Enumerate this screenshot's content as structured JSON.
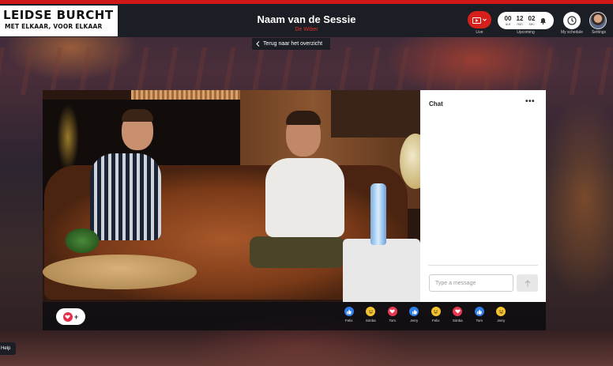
{
  "brand": {
    "line1": "LEIDSE BURCHT",
    "line2": "MET ELKAAR, VOOR ELKAAR"
  },
  "session": {
    "title": "Naam van de Sessie",
    "subtitle": "De Wiber"
  },
  "header": {
    "live_label": "Live",
    "countdown": [
      {
        "value": "00",
        "unit": "uur"
      },
      {
        "value": "12",
        "unit": "min"
      },
      {
        "value": "02",
        "unit": "sec"
      }
    ],
    "upcoming_label": "Upcoming",
    "schedule_label": "My schedule",
    "settings_label": "Settings"
  },
  "nav": {
    "back_label": "Terug naar het overzicht"
  },
  "chat": {
    "title": "Chat",
    "more": "•••",
    "input_placeholder": "Type a message"
  },
  "reactions": [
    {
      "type": "like",
      "name": "Felix"
    },
    {
      "type": "haha",
      "name": "Simba"
    },
    {
      "type": "love",
      "name": "Tom"
    },
    {
      "type": "like",
      "name": "Jerry"
    },
    {
      "type": "haha",
      "name": "Felix"
    },
    {
      "type": "love",
      "name": "Simba"
    },
    {
      "type": "like",
      "name": "Tom"
    },
    {
      "type": "haha",
      "name": "Jerry"
    }
  ],
  "help_label": "Help",
  "colors": {
    "accent_red": "#d6201b",
    "header_bg": "#1b1e24",
    "like_blue": "#2f7ee8",
    "haha_yellow": "#f2c230",
    "love_red": "#e73a52"
  }
}
